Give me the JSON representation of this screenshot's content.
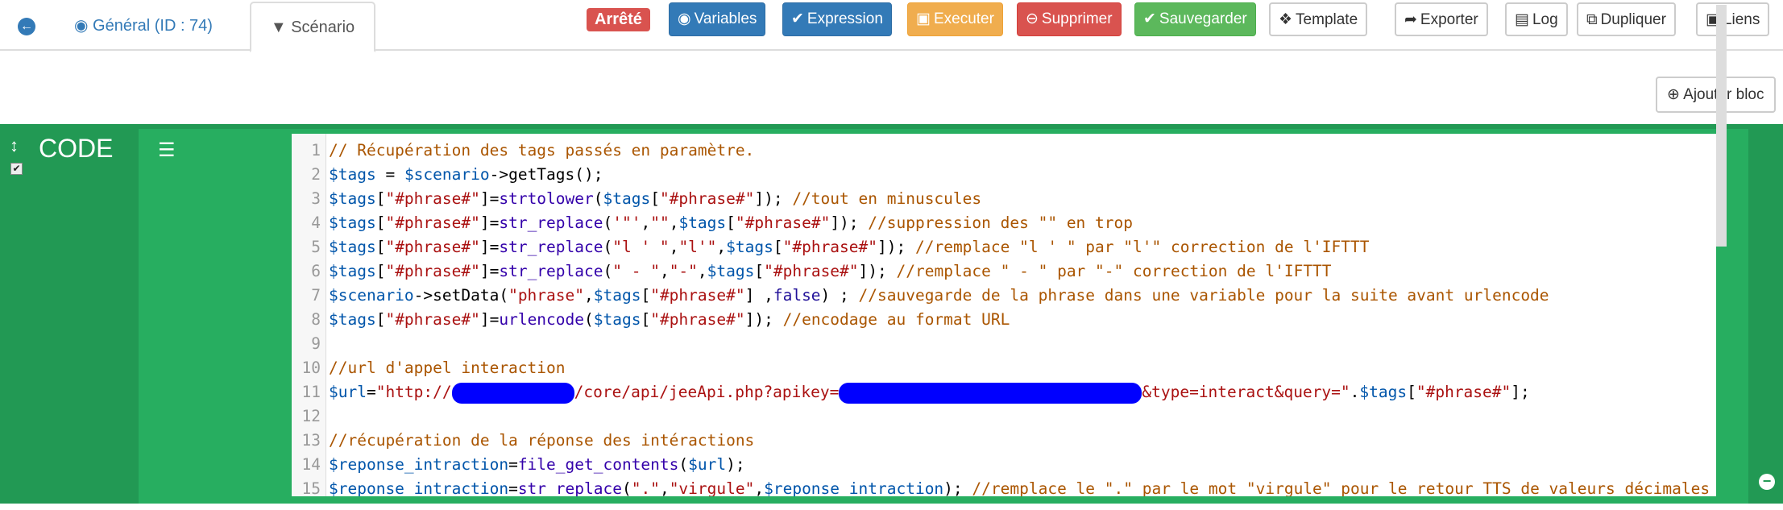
{
  "nav": {
    "back_icon": "arrow-circle-left-icon",
    "tabs": [
      {
        "label": "Général (ID : 74)",
        "icon": "dashboard-icon"
      },
      {
        "label": "Scénario",
        "icon": "filter-icon",
        "active": true
      }
    ]
  },
  "toolbar": {
    "status": "Arrêté",
    "buttons": [
      {
        "label": "Variables",
        "icon": "eye-icon",
        "color": "#337ab7"
      },
      {
        "label": "Expression",
        "icon": "check-icon",
        "color": "#337ab7"
      },
      {
        "label": "Executer",
        "icon": "gamepad-icon",
        "color": "#f0ad4e"
      },
      {
        "label": "Supprimer",
        "icon": "minus-circle-icon",
        "color": "#d9534f"
      },
      {
        "label": "Sauvegarder",
        "icon": "check-circle-icon",
        "color": "#5cb85c"
      },
      {
        "label": "Template",
        "icon": "cubes-icon"
      },
      {
        "label": "Exporter",
        "icon": "share-icon"
      },
      {
        "label": "Log",
        "icon": "file-text-icon"
      },
      {
        "label": "Dupliquer",
        "icon": "copy-icon"
      },
      {
        "label": "Liens",
        "icon": "object-group-icon"
      }
    ],
    "add_block": "Ajouter bloc"
  },
  "block": {
    "title": "CODE",
    "enabled": true,
    "color": "#27ae60",
    "lines": [
      [
        [
          "comment",
          "// Récupération des tags passés en paramètre."
        ]
      ],
      [
        [
          "var",
          "$tags"
        ],
        [
          "plain",
          " = "
        ],
        [
          "var",
          "$scenario"
        ],
        [
          "plain",
          "->getTags();"
        ]
      ],
      [
        [
          "var",
          "$tags"
        ],
        [
          "plain",
          "["
        ],
        [
          "str",
          "\"#phrase#\""
        ],
        [
          "plain",
          "]="
        ],
        [
          "builtin",
          "strtolower"
        ],
        [
          "plain",
          "("
        ],
        [
          "var",
          "$tags"
        ],
        [
          "plain",
          "["
        ],
        [
          "str",
          "\"#phrase#\""
        ],
        [
          "plain",
          "]); "
        ],
        [
          "comment",
          "//tout en minuscules"
        ]
      ],
      [
        [
          "var",
          "$tags"
        ],
        [
          "plain",
          "["
        ],
        [
          "str",
          "\"#phrase#\""
        ],
        [
          "plain",
          "]="
        ],
        [
          "builtin",
          "str_replace"
        ],
        [
          "plain",
          "("
        ],
        [
          "str",
          "'\"'"
        ],
        [
          "plain",
          ","
        ],
        [
          "str",
          "\"\""
        ],
        [
          "plain",
          ","
        ],
        [
          "var",
          "$tags"
        ],
        [
          "plain",
          "["
        ],
        [
          "str",
          "\"#phrase#\""
        ],
        [
          "plain",
          "]); "
        ],
        [
          "comment",
          "//suppression des \"\" en trop"
        ]
      ],
      [
        [
          "var",
          "$tags"
        ],
        [
          "plain",
          "["
        ],
        [
          "str",
          "\"#phrase#\""
        ],
        [
          "plain",
          "]="
        ],
        [
          "builtin",
          "str_replace"
        ],
        [
          "plain",
          "("
        ],
        [
          "str",
          "\"l ' \""
        ],
        [
          "plain",
          ","
        ],
        [
          "str",
          "\"l'\""
        ],
        [
          "plain",
          ","
        ],
        [
          "var",
          "$tags"
        ],
        [
          "plain",
          "["
        ],
        [
          "str",
          "\"#phrase#\""
        ],
        [
          "plain",
          "]); "
        ],
        [
          "comment",
          "//remplace \"l ' \" par \"l'\" correction de l'IFTTT"
        ]
      ],
      [
        [
          "var",
          "$tags"
        ],
        [
          "plain",
          "["
        ],
        [
          "str",
          "\"#phrase#\""
        ],
        [
          "plain",
          "]="
        ],
        [
          "builtin",
          "str_replace"
        ],
        [
          "plain",
          "("
        ],
        [
          "str",
          "\" - \""
        ],
        [
          "plain",
          ","
        ],
        [
          "str",
          "\"-\""
        ],
        [
          "plain",
          ","
        ],
        [
          "var",
          "$tags"
        ],
        [
          "plain",
          "["
        ],
        [
          "str",
          "\"#phrase#\""
        ],
        [
          "plain",
          "]); "
        ],
        [
          "comment",
          "//remplace \" - \" par \"-\" correction de l'IFTTT"
        ]
      ],
      [
        [
          "var",
          "$scenario"
        ],
        [
          "plain",
          "->setData("
        ],
        [
          "str",
          "\"phrase\""
        ],
        [
          "plain",
          ","
        ],
        [
          "var",
          "$tags"
        ],
        [
          "plain",
          "["
        ],
        [
          "str",
          "\"#phrase#\""
        ],
        [
          "plain",
          "] ,"
        ],
        [
          "atom",
          "false"
        ],
        [
          "plain",
          ") ; "
        ],
        [
          "comment",
          "//sauvegarde de la phrase dans une variable pour la suite avant urlencode"
        ]
      ],
      [
        [
          "var",
          "$tags"
        ],
        [
          "plain",
          "["
        ],
        [
          "str",
          "\"#phrase#\""
        ],
        [
          "plain",
          "]="
        ],
        [
          "builtin",
          "urlencode"
        ],
        [
          "plain",
          "("
        ],
        [
          "var",
          "$tags"
        ],
        [
          "plain",
          "["
        ],
        [
          "str",
          "\"#phrase#\""
        ],
        [
          "plain",
          "]); "
        ],
        [
          "comment",
          "//encodage au format URL"
        ]
      ],
      [],
      [
        [
          "comment",
          "//url d'appel interaction"
        ]
      ],
      [
        [
          "var",
          "$url"
        ],
        [
          "plain",
          "="
        ],
        [
          "str",
          "\"http://"
        ],
        [
          "redact1",
          ""
        ],
        [
          "str",
          "/core/api/jeeApi.php?apikey="
        ],
        [
          "redact2",
          ""
        ],
        [
          "str",
          "&type=interact&query=\""
        ],
        [
          "plain",
          "."
        ],
        [
          "var",
          "$tags"
        ],
        [
          "plain",
          "["
        ],
        [
          "str",
          "\"#phrase#\""
        ],
        [
          "plain",
          "];"
        ]
      ],
      [],
      [
        [
          "comment",
          "//récupération de la réponse des intéractions"
        ]
      ],
      [
        [
          "var",
          "$reponse_intraction"
        ],
        [
          "plain",
          "="
        ],
        [
          "builtin",
          "file_get_contents"
        ],
        [
          "plain",
          "("
        ],
        [
          "var",
          "$url"
        ],
        [
          "plain",
          ");"
        ]
      ],
      [
        [
          "var",
          "$reponse_intraction"
        ],
        [
          "plain",
          "="
        ],
        [
          "builtin",
          "str_replace"
        ],
        [
          "plain",
          "("
        ],
        [
          "str",
          "\".\""
        ],
        [
          "plain",
          ","
        ],
        [
          "str",
          "\"virgule\""
        ],
        [
          "plain",
          ","
        ],
        [
          "var",
          "$reponse_intraction"
        ],
        [
          "plain",
          "); "
        ],
        [
          "comment",
          "//remplace le \".\" par le mot \"virgule\" pour le retour TTS de valeurs décimales"
        ]
      ]
    ]
  }
}
